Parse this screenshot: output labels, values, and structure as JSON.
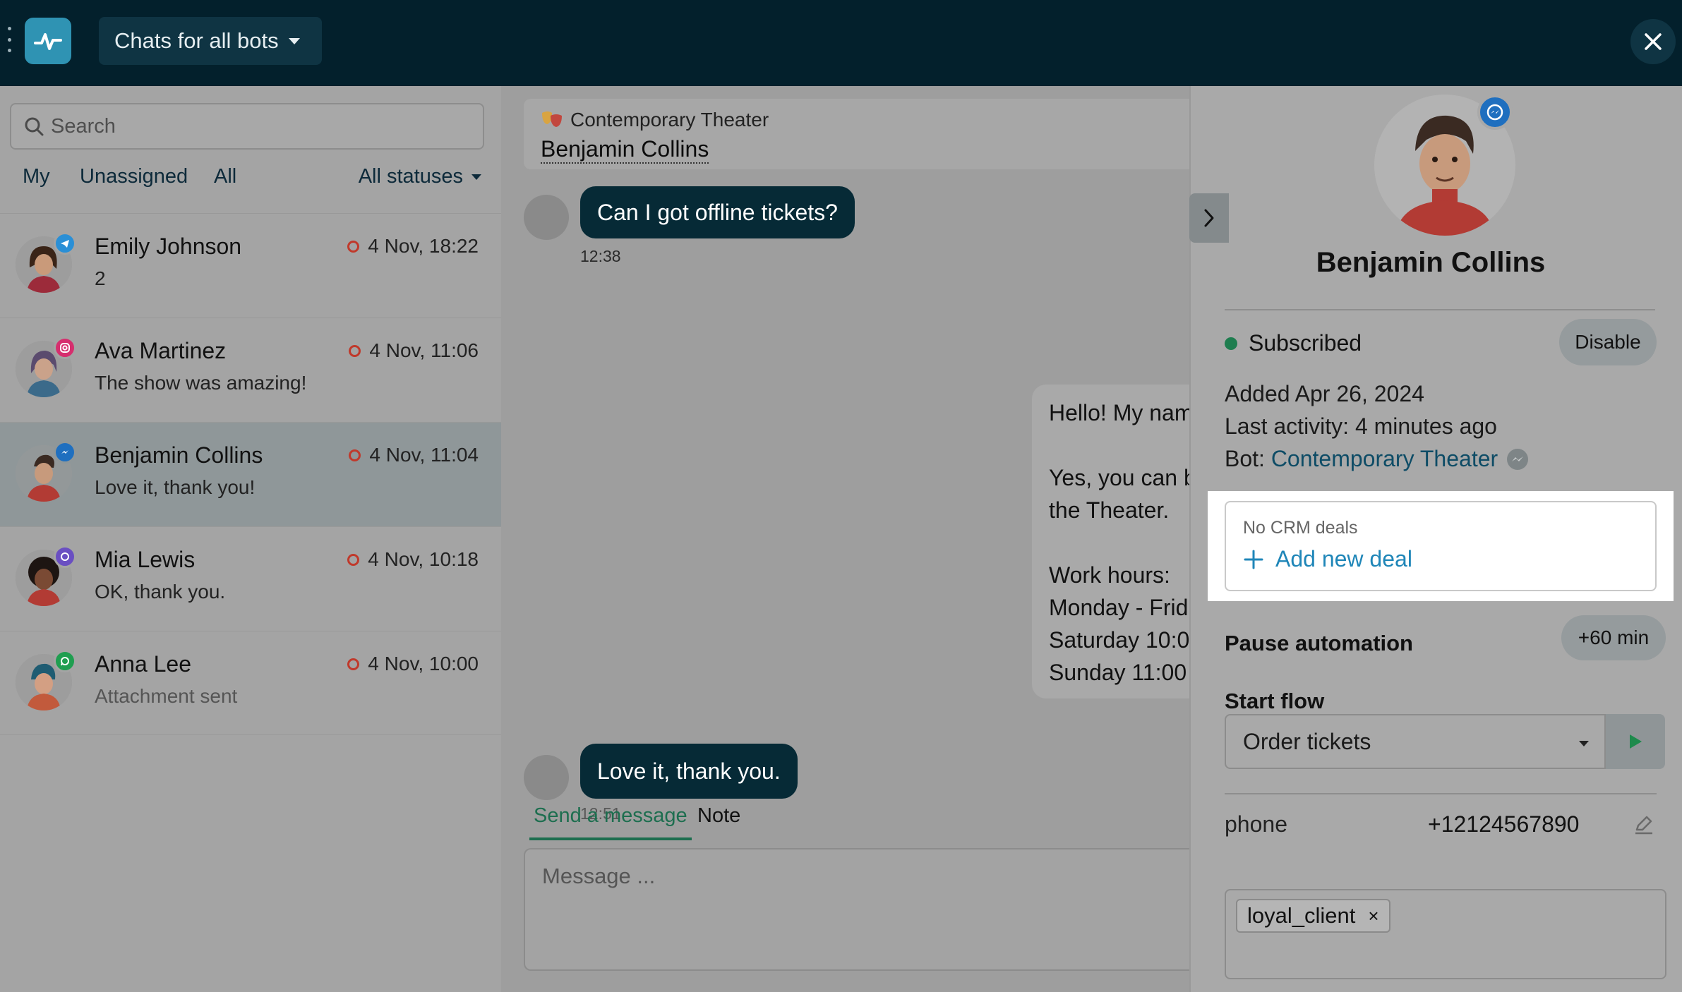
{
  "header": {
    "bot_selector_label": "Chats for all bots"
  },
  "search": {
    "placeholder": "Search"
  },
  "filters": {
    "my": "My",
    "unassigned": "Unassigned",
    "all": "All",
    "statuses": "All statuses"
  },
  "chats": [
    {
      "name": "Emily Johnson",
      "preview": "2",
      "time": "4 Nov, 18:22",
      "channel": "telegram-icon",
      "channel_color": "#2a8fd6"
    },
    {
      "name": "Ava Martinez",
      "preview": "The show was amazing!",
      "time": "4 Nov, 11:06",
      "channel": "instagram-icon",
      "channel_color": "#d62e6e"
    },
    {
      "name": "Benjamin Collins",
      "preview": "Love it, thank you!",
      "time": "4 Nov, 11:04",
      "channel": "messenger-icon",
      "channel_color": "#1f6fbf"
    },
    {
      "name": "Mia Lewis",
      "preview": "OK, thank you.",
      "time": "4 Nov, 10:18",
      "channel": "viber-icon",
      "channel_color": "#6a4fc2"
    },
    {
      "name": "Anna Lee",
      "preview": "Attachment sent",
      "time": "4 Nov, 10:00",
      "channel": "whatsapp-icon",
      "channel_color": "#1f9e50"
    }
  ],
  "conversation": {
    "bot_name": "Contemporary Theater",
    "user_name": "Benjamin Collins",
    "messages_in": [
      {
        "text": "Can I got offline tickets?",
        "time": "12:38"
      },
      {
        "text": "Love it, thank you.",
        "time": "12:51"
      }
    ],
    "reply_lines": [
      "Hello! My nam",
      "Yes, you can b",
      "the Theater.",
      "Work hours:",
      "Monday - Frid",
      "Saturday 10:0",
      "Sunday 11:00"
    ],
    "tab_send": "Send a message",
    "tab_note": "Note",
    "compose_placeholder": "Message ..."
  },
  "profile": {
    "name": "Benjamin Collins",
    "status": "Subscribed",
    "status_color": "#1e7d4f",
    "disable_label": "Disable",
    "added": "Added Apr 26, 2024",
    "last_activity": "Last activity: 4 minutes ago",
    "bot_prefix": "Bot: ",
    "bot_link": "Contemporary Theater",
    "crm_label": "No CRM deals",
    "add_deal": "Add new deal",
    "pause_title": "Pause automation",
    "pause_button": "+60 min",
    "start_flow_title": "Start flow",
    "flow_selected": "Order tickets",
    "phone_label": "phone",
    "phone_value": "+12124567890",
    "tag": "loyal_client"
  }
}
